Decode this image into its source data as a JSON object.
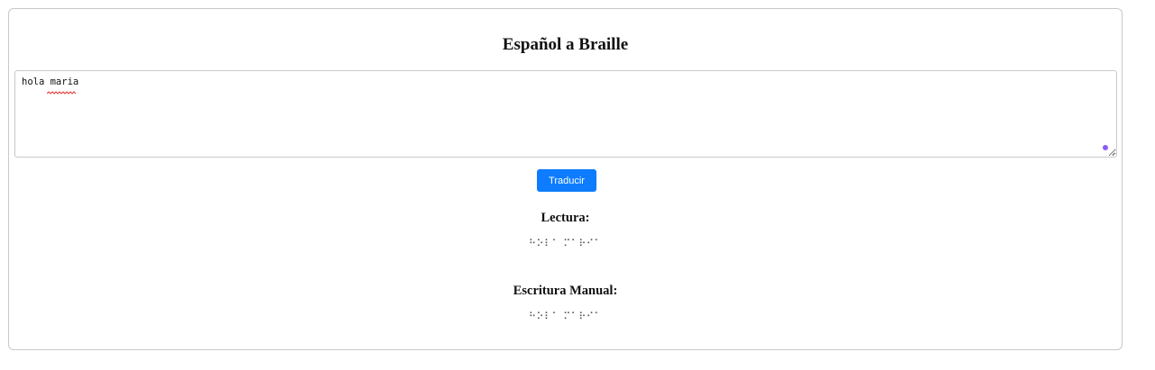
{
  "header": {
    "title": "Español a Braille"
  },
  "input": {
    "value": "hola maria"
  },
  "actions": {
    "translate_label": "Traducir"
  },
  "results": {
    "reading_label": "Lectura:",
    "reading_braille": "⠓⠕⠇⠁ ⠍⠁⠗⠊⠁",
    "writing_label": "Escritura Manual:",
    "writing_braille": "⠓⠕⠇⠁ ⠍⠁⠗⠊⠁"
  },
  "colors": {
    "accent": "#0d7cff",
    "grammar_dot": "#8b5cf6",
    "spellcheck": "#e53935"
  }
}
